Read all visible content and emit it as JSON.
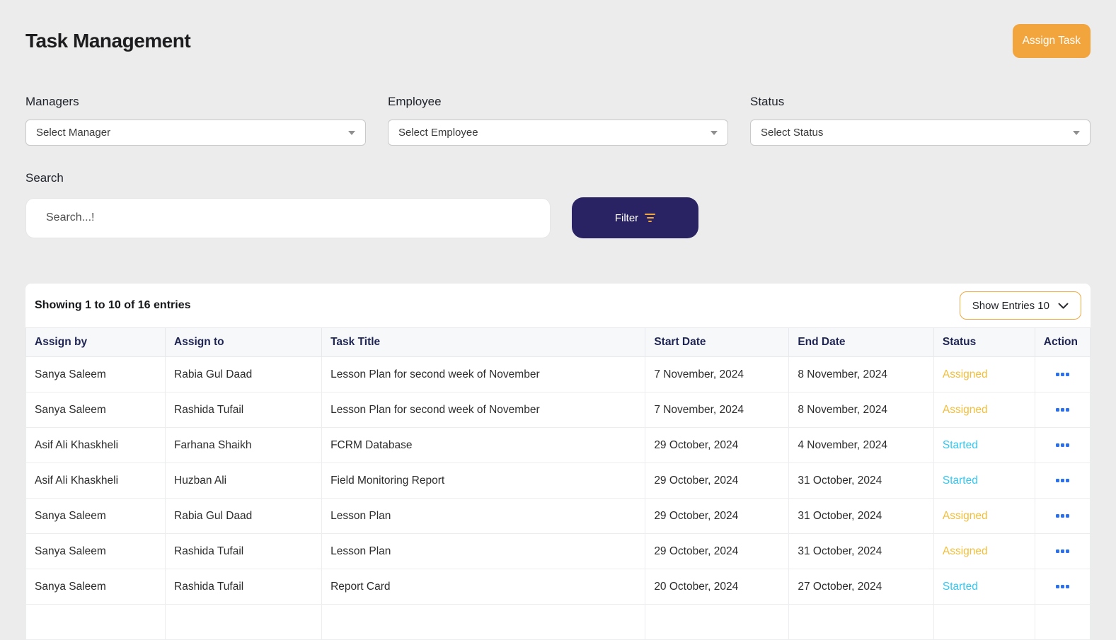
{
  "page": {
    "title": "Task Management",
    "assign_task_button": "Assign Task"
  },
  "filters": {
    "managers": {
      "label": "Managers",
      "selected": "Select Manager"
    },
    "employee": {
      "label": "Employee",
      "selected": "Select Employee"
    },
    "status": {
      "label": "Status",
      "selected": "Select Status"
    },
    "search": {
      "label": "Search",
      "placeholder": "Search...!"
    },
    "filter_button": {
      "label": "Filter"
    }
  },
  "table": {
    "summary": "Showing 1 to 10 of 16 entries",
    "show_entries_label": "Show Entries 10",
    "columns": [
      "Assign by",
      "Assign to",
      "Task Title",
      "Start Date",
      "End Date",
      "Status",
      "Action"
    ],
    "rows": [
      {
        "assign_by": "Sanya Saleem",
        "assign_to": "Rabia Gul Daad",
        "task_title": "Lesson Plan for second week of November",
        "start_date": "7 November, 2024",
        "end_date": "8 November, 2024",
        "status": "Assigned"
      },
      {
        "assign_by": "Sanya Saleem",
        "assign_to": "Rashida Tufail",
        "task_title": "Lesson Plan for second week of November",
        "start_date": "7 November, 2024",
        "end_date": "8 November, 2024",
        "status": "Assigned"
      },
      {
        "assign_by": "Asif Ali Khaskheli",
        "assign_to": "Farhana Shaikh",
        "task_title": "FCRM Database",
        "start_date": "29 October, 2024",
        "end_date": "4 November, 2024",
        "status": "Started"
      },
      {
        "assign_by": "Asif Ali Khaskheli",
        "assign_to": "Huzban Ali",
        "task_title": "Field Monitoring Report",
        "start_date": "29 October, 2024",
        "end_date": "31 October, 2024",
        "status": "Started"
      },
      {
        "assign_by": "Sanya Saleem",
        "assign_to": "Rabia Gul Daad",
        "task_title": "Lesson Plan",
        "start_date": "29 October, 2024",
        "end_date": "31 October, 2024",
        "status": "Assigned"
      },
      {
        "assign_by": "Sanya Saleem",
        "assign_to": "Rashida Tufail",
        "task_title": "Lesson Plan",
        "start_date": "29 October, 2024",
        "end_date": "31 October, 2024",
        "status": "Assigned"
      },
      {
        "assign_by": "Sanya Saleem",
        "assign_to": "Rashida Tufail",
        "task_title": "Report Card",
        "start_date": "20 October, 2024",
        "end_date": "27 October, 2024",
        "status": "Started"
      }
    ]
  },
  "colors": {
    "page_background": "#ECECEC",
    "accent_orange": "#F2A43D",
    "filter_button_navy": "#292363",
    "funnel_icon_orange": "#F0A63F",
    "show_entries_border": "#F0A840",
    "table_header_text": "#1E2553",
    "status": {
      "Assigned": "#F2BE3B",
      "Started": "#33C9F2"
    },
    "action_dots": "#2B6FEB"
  }
}
